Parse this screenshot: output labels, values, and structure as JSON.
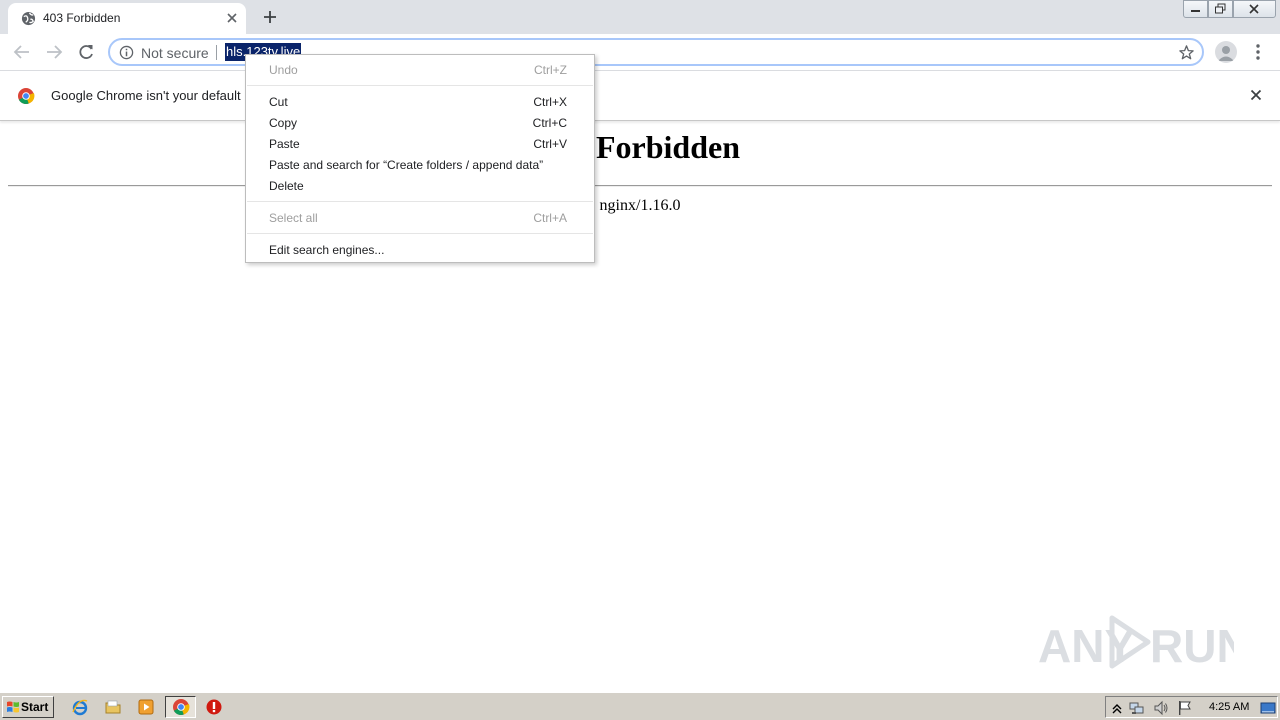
{
  "browser": {
    "tab": {
      "title": "403 Forbidden"
    },
    "omnibox": {
      "security_label": "Not secure",
      "url": "hls.123tv.live"
    },
    "infobar": {
      "message": "Google Chrome isn't your default br"
    }
  },
  "page": {
    "heading": "403 Forbidden",
    "footer": "nginx/1.16.0"
  },
  "context_menu": {
    "items": [
      {
        "label": "Undo",
        "shortcut": "Ctrl+Z",
        "enabled": false
      },
      {
        "label": "Cut",
        "shortcut": "Ctrl+X",
        "enabled": true
      },
      {
        "label": "Copy",
        "shortcut": "Ctrl+C",
        "enabled": true
      },
      {
        "label": "Paste",
        "shortcut": "Ctrl+V",
        "enabled": true
      },
      {
        "label": "Paste and search for “Create folders / append data”",
        "shortcut": "",
        "enabled": true
      },
      {
        "label": "Delete",
        "shortcut": "",
        "enabled": true
      },
      {
        "label": "Select all",
        "shortcut": "Ctrl+A",
        "enabled": false
      },
      {
        "label": "Edit search engines...",
        "shortcut": "",
        "enabled": true
      }
    ]
  },
  "watermark": {
    "text": "ANY RUN"
  },
  "taskbar": {
    "start_label": "Start",
    "pinned": [
      "internet-explorer-icon",
      "folder-icon",
      "media-player-icon",
      "chrome-icon",
      "stop-icon"
    ],
    "tray_icons": [
      "show-hidden-icon",
      "network-icon",
      "volume-icon",
      "flag-icon",
      "desktop-icon"
    ],
    "clock": "4:25 AM"
  },
  "colors": {
    "selection": "#0a246a",
    "omnibox_focus": "#a8c7fa",
    "tab_strip": "#dee1e6",
    "taskbar": "#d4d0c8"
  }
}
